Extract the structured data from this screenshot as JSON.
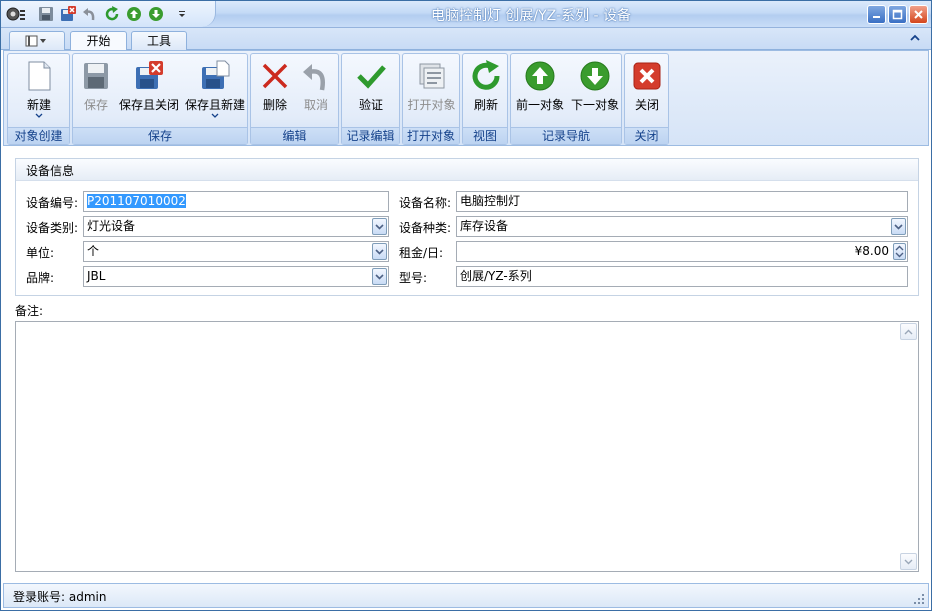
{
  "window": {
    "title": "电脑控制灯 创展/YZ-系列 - 设备"
  },
  "quick_access": {
    "items": [
      "app-menu-icon",
      "save-icon",
      "save-close-icon",
      "undo-icon",
      "refresh-icon",
      "previous-icon",
      "next-icon",
      "customize-icon"
    ]
  },
  "tabs": [
    {
      "label": "开始",
      "active": true
    },
    {
      "label": "工具",
      "active": false
    }
  ],
  "ribbon": {
    "groups": [
      {
        "label": "对象创建",
        "buttons": [
          {
            "label": "新建",
            "icon": "new-document-icon",
            "enabled": true
          }
        ]
      },
      {
        "label": "保存",
        "buttons": [
          {
            "label": "保存",
            "icon": "save-icon",
            "enabled": false
          },
          {
            "label": "保存且关闭",
            "icon": "save-close-icon",
            "enabled": true
          },
          {
            "label": "保存且新建",
            "icon": "save-new-icon",
            "enabled": true
          }
        ]
      },
      {
        "label": "编辑",
        "buttons": [
          {
            "label": "删除",
            "icon": "delete-icon",
            "enabled": true
          },
          {
            "label": "取消",
            "icon": "undo-icon",
            "enabled": false
          }
        ]
      },
      {
        "label": "记录编辑",
        "buttons": [
          {
            "label": "验证",
            "icon": "validate-check-icon",
            "enabled": true
          }
        ]
      },
      {
        "label": "打开对象",
        "buttons": [
          {
            "label": "打开对象",
            "icon": "open-object-icon",
            "enabled": false
          }
        ]
      },
      {
        "label": "视图",
        "buttons": [
          {
            "label": "刷新",
            "icon": "refresh-icon",
            "enabled": true
          }
        ]
      },
      {
        "label": "记录导航",
        "buttons": [
          {
            "label": "前一对象",
            "icon": "previous-arrow-icon",
            "enabled": true
          },
          {
            "label": "下一对象",
            "icon": "next-arrow-icon",
            "enabled": true
          }
        ]
      },
      {
        "label": "关闭",
        "buttons": [
          {
            "label": "关闭",
            "icon": "close-red-icon",
            "enabled": true
          }
        ]
      }
    ]
  },
  "panel": {
    "title": "设备信息",
    "fields": {
      "code": {
        "label": "设备编号:",
        "value": "P201107010002"
      },
      "name": {
        "label": "设备名称:",
        "value": "电脑控制灯"
      },
      "category": {
        "label": "设备类别:",
        "value": "灯光设备"
      },
      "kind": {
        "label": "设备种类:",
        "value": "库存设备"
      },
      "unit": {
        "label": "单位:",
        "value": "个"
      },
      "rent": {
        "label": "租金/日:",
        "value": "¥8.00"
      },
      "brand": {
        "label": "品牌:",
        "value": "JBL"
      },
      "model": {
        "label": "型号:",
        "value": "创展/YZ-系列"
      }
    }
  },
  "remark": {
    "label": "备注:",
    "value": ""
  },
  "status": {
    "text": "登录账号: admin"
  },
  "colors": {
    "accent": "#3399ff",
    "title_text": "#ffffff",
    "group_label": "#15428b",
    "close_red": "#d4461d"
  }
}
